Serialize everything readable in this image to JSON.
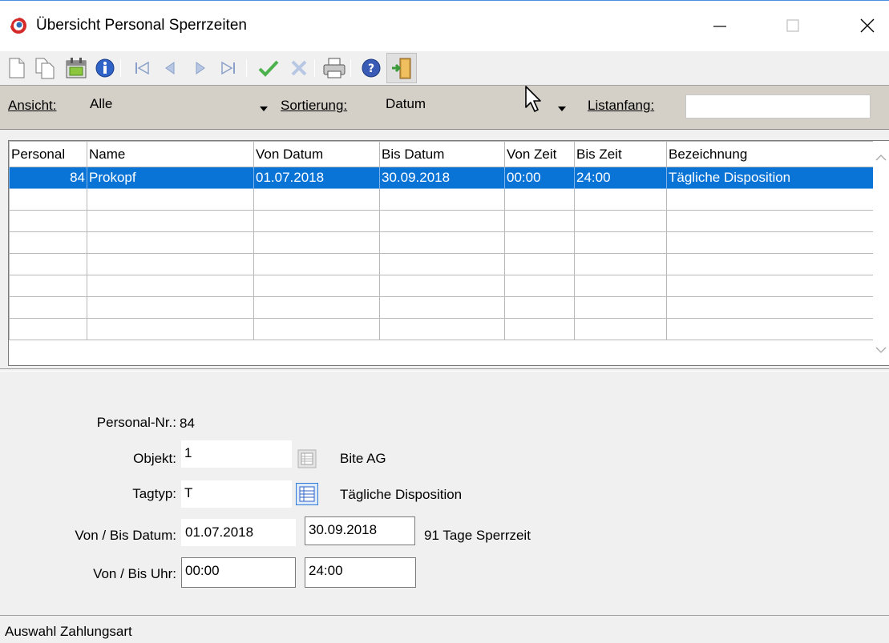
{
  "window": {
    "title": "Übersicht Personal Sperrzeiten"
  },
  "toolbar": {
    "icons": [
      "new-document-icon",
      "copy-document-icon",
      "calendar-icon",
      "info-icon",
      "first-record-icon",
      "previous-record-icon",
      "next-record-icon",
      "last-record-icon",
      "confirm-check-icon",
      "cancel-x-icon",
      "print-icon",
      "help-icon",
      "exit-door-icon"
    ]
  },
  "filter": {
    "ansicht_label": "Ansicht:",
    "ansicht_value": "Alle",
    "sortierung_label": "Sortierung:",
    "sortierung_value": "Datum",
    "listanfang_label": "Listanfang:",
    "listanfang_value": ""
  },
  "grid": {
    "columns": [
      "Personal",
      "Name",
      "Von Datum",
      "Bis Datum",
      "Von Zeit",
      "Bis Zeit",
      "Bezeichnung"
    ],
    "rows": [
      [
        "84",
        "Prokopf",
        "01.07.2018",
        "30.09.2018",
        "00:00",
        "24:00",
        "Tägliche Disposition"
      ]
    ]
  },
  "form": {
    "personal_nr_label": "Personal-Nr.:",
    "personal_nr_value": "84",
    "objekt_label": "Objekt:",
    "objekt_value": "1",
    "objekt_name": "Bite AG",
    "tagtyp_label": "Tagtyp:",
    "tagtyp_value": "T",
    "tagtyp_name": "Tägliche Disposition",
    "datum_label": "Von / Bis Datum:",
    "von_datum": "01.07.2018",
    "bis_datum": "30.09.2018",
    "sperrzeit_text": "91 Tage Sperrzeit",
    "uhr_label": "Von / Bis Uhr:",
    "von_uhr": "00:00",
    "bis_uhr": "24:00"
  },
  "status": {
    "text": "Auswahl Zahlungsart"
  },
  "colors": {
    "selection": "#0a74d6",
    "filterbar": "#d4d0c8",
    "background": "#f0f0f0"
  }
}
